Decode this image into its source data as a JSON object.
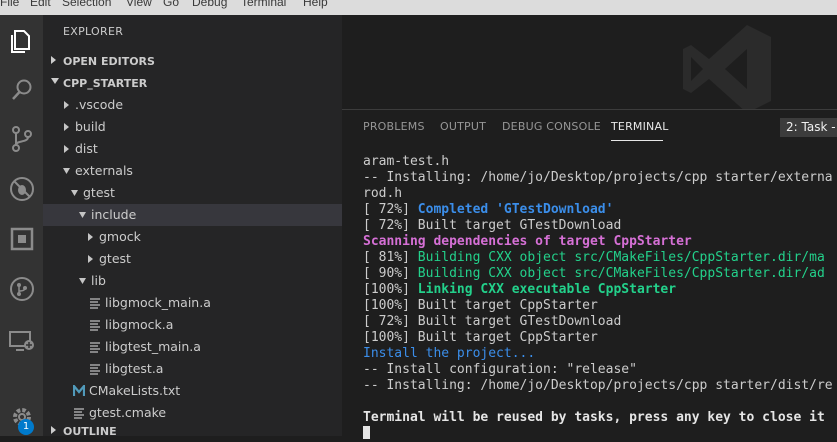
{
  "menu": [
    "File",
    "Edit",
    "Selection",
    "View",
    "Go",
    "Debug",
    "Terminal",
    "Help"
  ],
  "activity_bar": {
    "icons": [
      "files-icon",
      "search-icon",
      "source-control-icon",
      "debug-icon",
      "extensions-icon",
      "git-lens-icon",
      "remote-explorer-icon",
      "settings-gear-icon"
    ],
    "badge": "1"
  },
  "sidebar": {
    "title": "EXPLORER",
    "open_editors": "OPEN EDITORS",
    "project": "CPP_STARTER",
    "outline": "OUTLINE",
    "tree": [
      {
        "label": ".vscode",
        "type": "folder",
        "depth": 1,
        "open": false
      },
      {
        "label": "build",
        "type": "folder",
        "depth": 1,
        "open": false
      },
      {
        "label": "dist",
        "type": "folder",
        "depth": 1,
        "open": false
      },
      {
        "label": "externals",
        "type": "folder",
        "depth": 1,
        "open": true
      },
      {
        "label": "gtest",
        "type": "folder",
        "depth": 2,
        "open": true
      },
      {
        "label": "include",
        "type": "folder",
        "depth": 3,
        "open": true,
        "selected": true
      },
      {
        "label": "gmock",
        "type": "folder",
        "depth": 4,
        "open": false
      },
      {
        "label": "gtest",
        "type": "folder",
        "depth": 4,
        "open": false
      },
      {
        "label": "lib",
        "type": "folder",
        "depth": 3,
        "open": true
      },
      {
        "label": "libgmock_main.a",
        "type": "file",
        "depth": 4
      },
      {
        "label": "libgmock.a",
        "type": "file",
        "depth": 4
      },
      {
        "label": "libgtest_main.a",
        "type": "file",
        "depth": 4
      },
      {
        "label": "libgtest.a",
        "type": "file",
        "depth": 4
      },
      {
        "label": "CMakeLists.txt",
        "type": "cmake",
        "depth": 2
      },
      {
        "label": "gtest.cmake",
        "type": "file",
        "depth": 2
      }
    ]
  },
  "panel": {
    "tabs": [
      "PROBLEMS",
      "OUTPUT",
      "DEBUG CONSOLE",
      "TERMINAL"
    ],
    "active_tab": "TERMINAL",
    "task_select": "2: Task -"
  },
  "terminal": {
    "lines": [
      [
        {
          "t": "aram-test.h",
          "c": ""
        }
      ],
      [
        {
          "t": "-- Installing: /home/jo/Desktop/projects/cpp starter/externa",
          "c": ""
        }
      ],
      [
        {
          "t": "rod.h",
          "c": ""
        }
      ],
      [
        {
          "t": "[ 72%] ",
          "c": ""
        },
        {
          "t": "Completed 'GTestDownload'",
          "c": "c-blue"
        }
      ],
      [
        {
          "t": "[ 72%] Built target GTestDownload",
          "c": ""
        }
      ],
      [
        {
          "t": "Scanning dependencies of target CppStarter",
          "c": "c-mag"
        }
      ],
      [
        {
          "t": "[ 81%] ",
          "c": ""
        },
        {
          "t": "Building CXX object src/CMakeFiles/CppStarter.dir/ma",
          "c": "c-green"
        }
      ],
      [
        {
          "t": "[ 90%] ",
          "c": ""
        },
        {
          "t": "Building CXX object src/CMakeFiles/CppStarter.dir/ad",
          "c": "c-green"
        }
      ],
      [
        {
          "t": "[100%] ",
          "c": ""
        },
        {
          "t": "Linking CXX executable CppStarter",
          "c": "c-green-b"
        }
      ],
      [
        {
          "t": "[100%] Built target CppStarter",
          "c": ""
        }
      ],
      [
        {
          "t": "[ 72%] Built target GTestDownload",
          "c": ""
        }
      ],
      [
        {
          "t": "[100%] Built target CppStarter",
          "c": ""
        }
      ],
      [
        {
          "t": "Install the project...",
          "c": "c-blue-n"
        }
      ],
      [
        {
          "t": "-- Install configuration: \"release\"",
          "c": ""
        }
      ],
      [
        {
          "t": "-- Installing: /home/jo/Desktop/projects/cpp starter/dist/re",
          "c": ""
        }
      ],
      [
        {
          "t": "",
          "c": ""
        }
      ],
      [
        {
          "t": "Terminal will be reused by tasks, press any key to close it",
          "c": "c-bold"
        }
      ]
    ]
  }
}
